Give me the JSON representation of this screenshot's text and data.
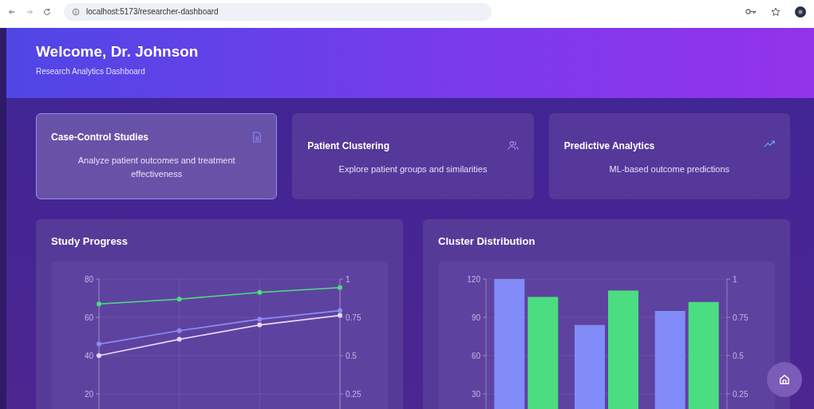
{
  "browser": {
    "url": "localhost:5173/researcher-dashboard"
  },
  "header": {
    "title": "Welcome, Dr. Johnson",
    "subtitle": "Research Analytics Dashboard"
  },
  "cards": [
    {
      "title": "Case-Control Studies",
      "description": "Analyze patient outcomes and treatment effectiveness",
      "kind": "document",
      "selected": true
    },
    {
      "title": "Patient Clustering",
      "description": "Explore patient groups and similarities",
      "kind": "users",
      "selected": false
    },
    {
      "title": "Predictive Analytics",
      "description": "ML-based outcome predictions",
      "kind": "trend",
      "selected": false
    }
  ],
  "panels": [
    {
      "title": "Study Progress",
      "chart_data": {
        "type": "line",
        "grid": true,
        "ylim": [
          0,
          80
        ],
        "yticks": [
          20,
          40,
          60,
          80
        ],
        "y2lim": [
          0,
          1
        ],
        "y2ticks": [
          0.25,
          0.5,
          0.75,
          1
        ],
        "series": [
          {
            "color": "#4ade80",
            "marker": true,
            "values": [
              67,
              69.5,
              73,
              75.5
            ]
          },
          {
            "color": "#8b8cf5",
            "marker": true,
            "values": [
              46,
              53,
              59,
              63.5
            ]
          },
          {
            "color": "#e9d5ff",
            "marker": true,
            "values": [
              40,
              48.5,
              56,
              61
            ]
          }
        ]
      }
    },
    {
      "title": "Cluster Distribution",
      "chart_data": {
        "type": "bar",
        "grid": true,
        "ylim": [
          0,
          120
        ],
        "yticks": [
          30,
          60,
          90,
          120
        ],
        "y2lim": [
          0,
          1
        ],
        "y2ticks": [
          0.25,
          0.5,
          0.75,
          1
        ],
        "series": [
          {
            "color": "#818cf8",
            "values": [
              120,
              84,
              95
            ]
          },
          {
            "color": "#4ade80",
            "values": [
              106,
              111,
              102
            ]
          }
        ]
      }
    }
  ]
}
